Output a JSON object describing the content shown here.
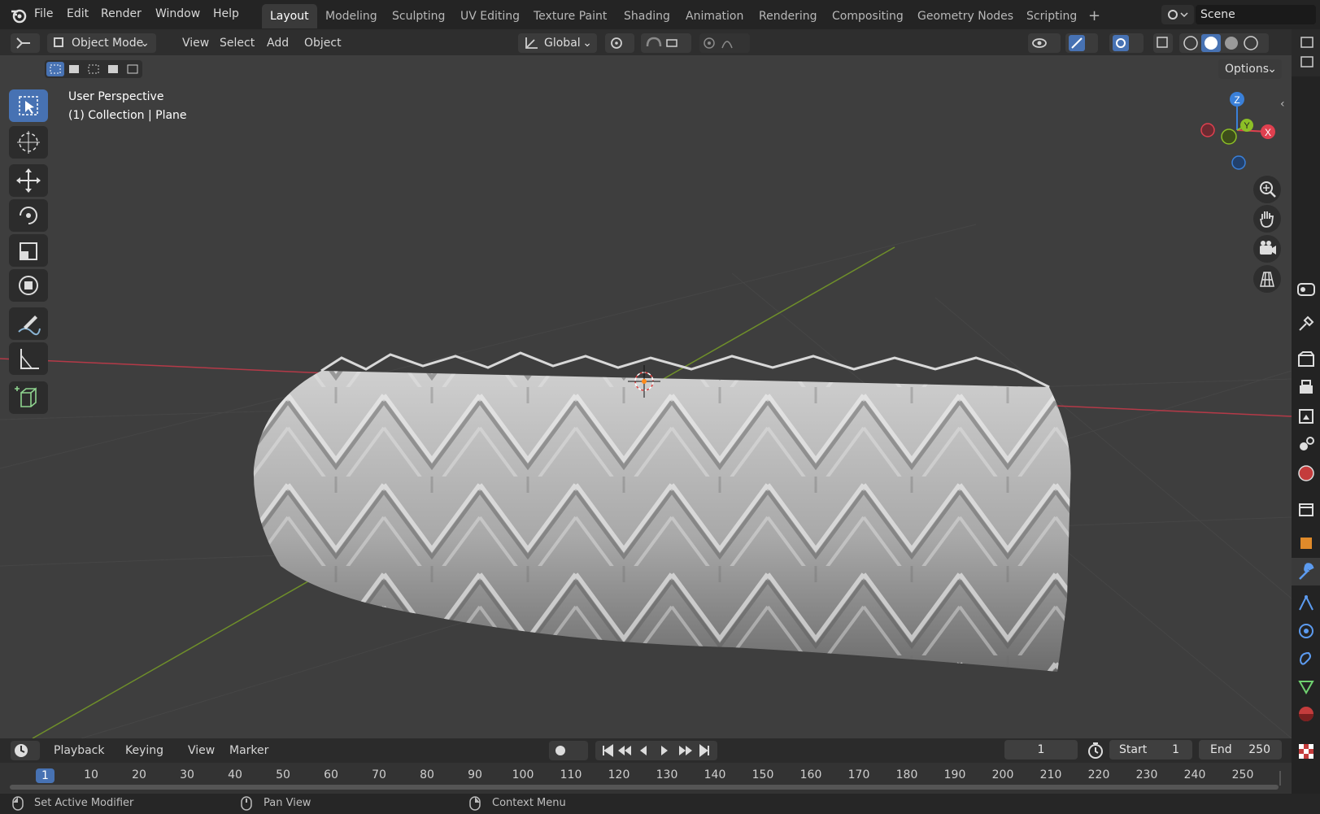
{
  "menu": [
    "File",
    "Edit",
    "Render",
    "Window",
    "Help"
  ],
  "workspaces": [
    "Layout",
    "Modeling",
    "Sculpting",
    "UV Editing",
    "Texture Paint",
    "Shading",
    "Animation",
    "Rendering",
    "Compositing",
    "Geometry Nodes",
    "Scripting"
  ],
  "scene_name": "Scene",
  "viewport_header": {
    "mode": "Object Mode",
    "menus": [
      "View",
      "Select",
      "Add",
      "Object"
    ],
    "transform_orientation": "Global",
    "options_label": "Options"
  },
  "overlay": {
    "line1": "User Perspective",
    "line2": "(1) Collection | Plane"
  },
  "gizmo": {
    "x": "X",
    "y": "Y",
    "z": "Z"
  },
  "toolbar_icons": [
    "select-box-icon",
    "cursor-icon",
    "move-icon",
    "rotate-icon",
    "scale-icon",
    "transform-icon",
    "annotate-icon",
    "measure-icon",
    "add-cube-icon"
  ],
  "timeline": {
    "menus": [
      "Playback",
      "Keying",
      "View",
      "Marker"
    ],
    "current_frame": "1",
    "start_label": "Start",
    "start": "1",
    "end_label": "End",
    "end": "250",
    "ticks": [
      "1",
      "10",
      "20",
      "30",
      "40",
      "50",
      "60",
      "70",
      "80",
      "90",
      "100",
      "110",
      "120",
      "130",
      "140",
      "150",
      "160",
      "170",
      "180",
      "190",
      "200",
      "210",
      "220",
      "230",
      "240",
      "250"
    ]
  },
  "status": [
    "Set Active Modifier",
    "Pan View",
    "Context Menu"
  ],
  "colors": {
    "accent": "#4772b3",
    "axis_x": "#e0404f",
    "axis_y": "#8cbf26",
    "axis_z": "#3a80d9"
  }
}
